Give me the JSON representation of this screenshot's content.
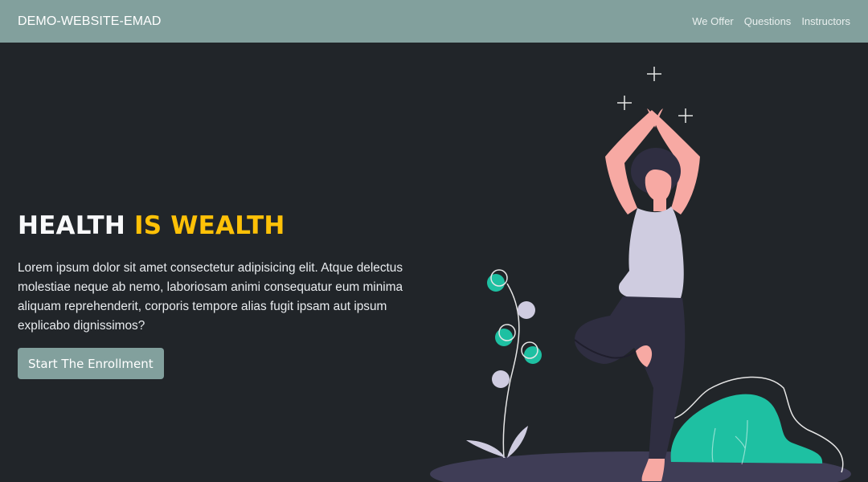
{
  "navbar": {
    "brand": "DEMO-WEBSITE-EMAD",
    "links": [
      "We Offer",
      "Questions",
      "Instructors"
    ]
  },
  "hero": {
    "title_part1": "HEALTH ",
    "title_part2": "IS WEALTH",
    "description": "Lorem ipsum dolor sit amet consectetur adipisicing elit. Atque delectus molestiae neque ab nemo, laboriosam animi consequatur eum minima aliquam reprehenderit, corporis tempore alias fugit ipsam aut ipsum explicabo dignissimos?",
    "cta_label": "Start The Enrollment"
  },
  "colors": {
    "navbar_bg": "#82a09d",
    "page_bg": "#212529",
    "accent": "#ffc107",
    "teal": "#1ec0a2",
    "skin": "#f7a9a3",
    "shirt": "#cfcce0",
    "pants": "#2f2e41",
    "ground": "#3f3d56"
  },
  "illustration": {
    "icon": "yoga-woman-illustration"
  }
}
